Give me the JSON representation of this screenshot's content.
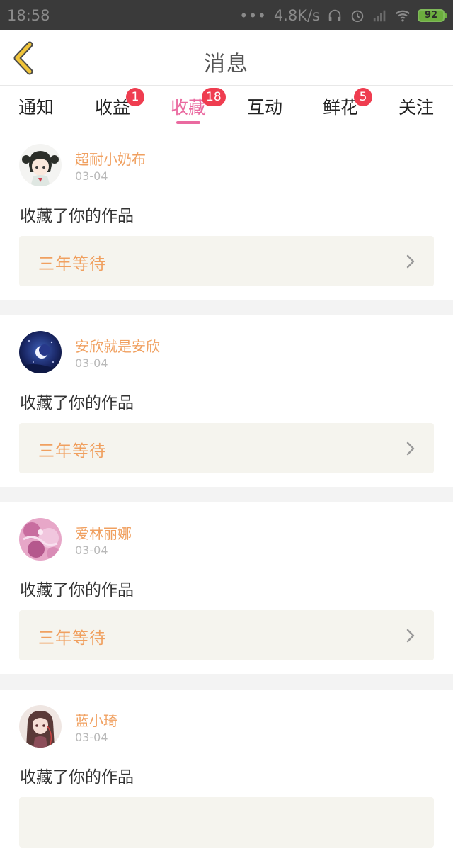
{
  "status_bar": {
    "time": "18:58",
    "dots": "•••",
    "speed": "4.8K/s",
    "battery": "92"
  },
  "header": {
    "title": "消息"
  },
  "tabs": [
    {
      "label": "通知",
      "badge": ""
    },
    {
      "label": "收益",
      "badge": "1"
    },
    {
      "label": "收藏",
      "badge": "18",
      "active": true
    },
    {
      "label": "互动",
      "badge": ""
    },
    {
      "label": "鲜花",
      "badge": "5"
    },
    {
      "label": "关注",
      "badge": ""
    }
  ],
  "feed": [
    {
      "username": "超耐小奶布",
      "date": "03-04",
      "action": "收藏了你的作品",
      "work": "三年等待",
      "avatar": "anime-girl-avatar"
    },
    {
      "username": "安欣就是安欣",
      "date": "03-04",
      "action": "收藏了你的作品",
      "work": "三年等待",
      "avatar": "moon-night-avatar"
    },
    {
      "username": "爱林丽娜",
      "date": "03-04",
      "action": "收藏了你的作品",
      "work": "三年等待",
      "avatar": "pink-floral-avatar"
    },
    {
      "username": "蓝小琦",
      "date": "03-04",
      "action": "收藏了你的作品",
      "work": "",
      "avatar": "long-hair-girl-avatar"
    }
  ],
  "colors": {
    "accent": "#ea6aa0",
    "badge": "#ef3d50",
    "username": "#f0a060",
    "back_arrow": "#f0c43a"
  }
}
